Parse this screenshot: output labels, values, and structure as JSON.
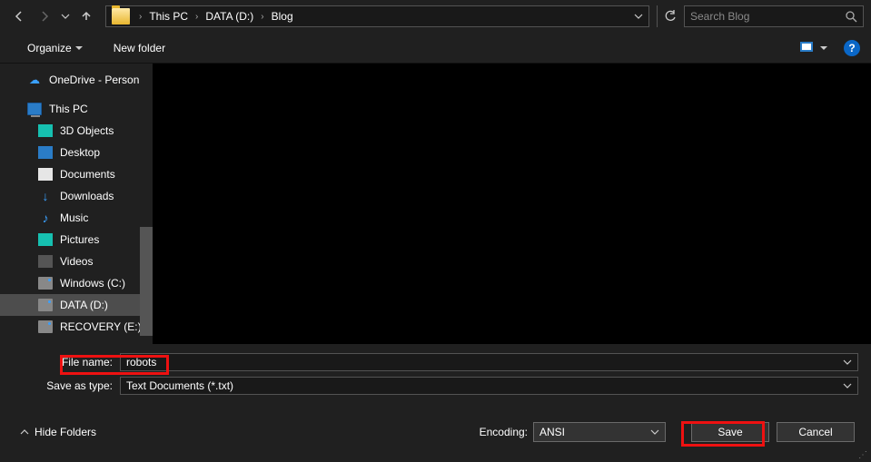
{
  "nav": {
    "back": "←",
    "forward": "→",
    "up": "↑"
  },
  "breadcrumb": {
    "seg1": "This PC",
    "seg2": "DATA (D:)",
    "seg3": "Blog"
  },
  "search": {
    "placeholder": "Search Blog"
  },
  "toolbar": {
    "organize": "Organize",
    "new_folder": "New folder"
  },
  "tree": {
    "onedrive": "OneDrive - Person",
    "thispc": "This PC",
    "obj3d": "3D Objects",
    "desktop": "Desktop",
    "documents": "Documents",
    "downloads": "Downloads",
    "music": "Music",
    "pictures": "Pictures",
    "videos": "Videos",
    "winc": "Windows (C:)",
    "datad": "DATA (D:)",
    "rece": "RECOVERY (E:)"
  },
  "fields": {
    "file_name_label": "File name:",
    "file_name_value": "robots",
    "save_type_label": "Save as type:",
    "save_type_value": "Text Documents (*.txt)"
  },
  "footer": {
    "hide_folders": "Hide Folders",
    "encoding_label": "Encoding:",
    "encoding_value": "ANSI",
    "save": "Save",
    "cancel": "Cancel"
  }
}
